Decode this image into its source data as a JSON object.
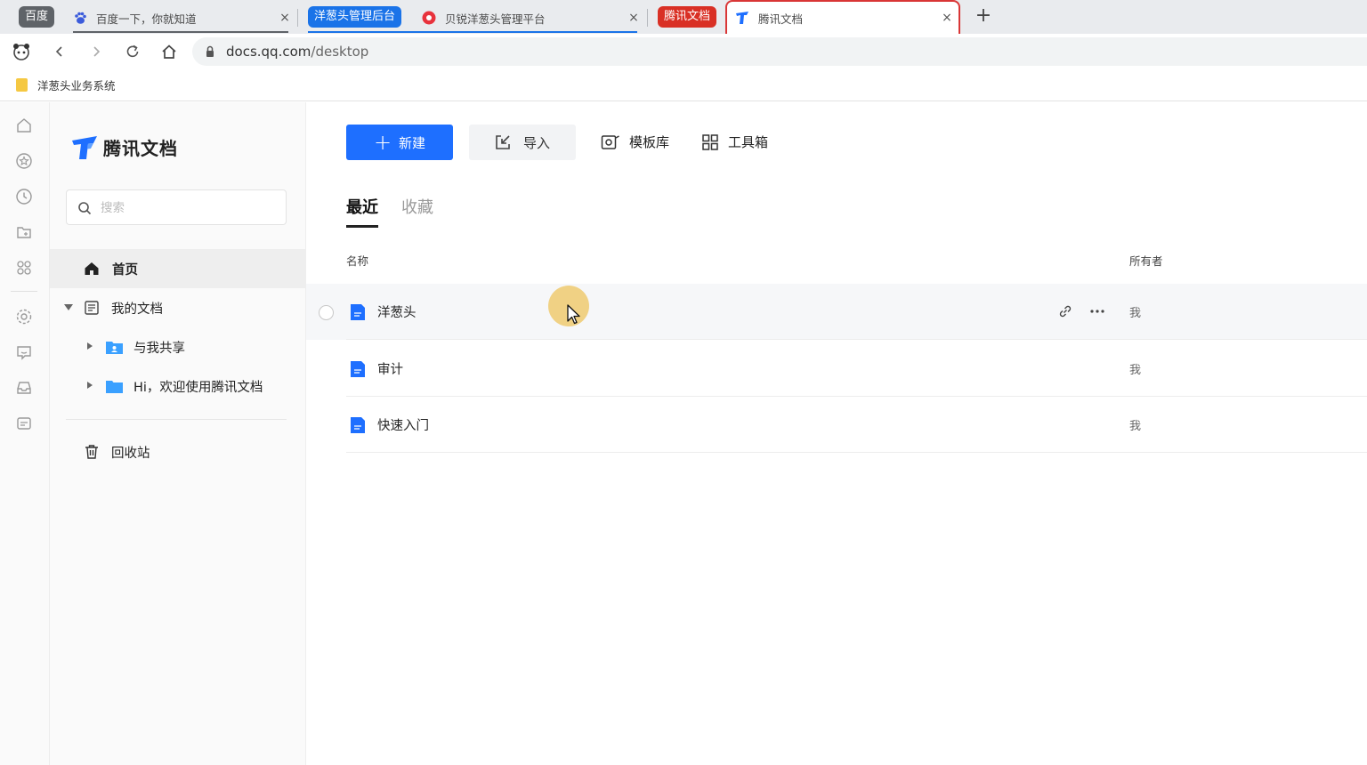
{
  "browser": {
    "tab_groups": [
      {
        "label": "百度",
        "color": "#5f6368"
      },
      {
        "label": "洋葱头管理后台",
        "color": "#1a73e8"
      },
      {
        "label": "腾讯文档",
        "color": "#d93025"
      }
    ],
    "tabs": [
      {
        "title": "百度一下，你就知道",
        "close": "×"
      },
      {
        "title": "贝锐洋葱头管理平台",
        "close": "×"
      },
      {
        "title": "腾讯文档",
        "close": "×"
      }
    ],
    "new_tab": "+",
    "url_host": "docs.qq.com",
    "url_path": "/desktop",
    "bookmarks": [
      {
        "label": "洋葱头业务系统"
      }
    ]
  },
  "app": {
    "brand": "腾讯文档",
    "brand_color": "#1e6fff",
    "search_placeholder": "搜索",
    "nav": {
      "home": "首页",
      "my_docs": "我的文档",
      "shared": "与我共享",
      "welcome_folder": "Hi，欢迎使用腾讯文档",
      "trash": "回收站"
    },
    "toolbar": {
      "new": "新建",
      "import": "导入",
      "templates": "模板库",
      "toolbox": "工具箱"
    },
    "tabs": {
      "recent": "最近",
      "favorites": "收藏"
    },
    "columns": {
      "name": "名称",
      "owner": "所有者"
    },
    "files": [
      {
        "name": "洋葱头",
        "owner": "我"
      },
      {
        "name": "审计",
        "owner": "我"
      },
      {
        "name": "快速入门",
        "owner": "我"
      }
    ]
  }
}
